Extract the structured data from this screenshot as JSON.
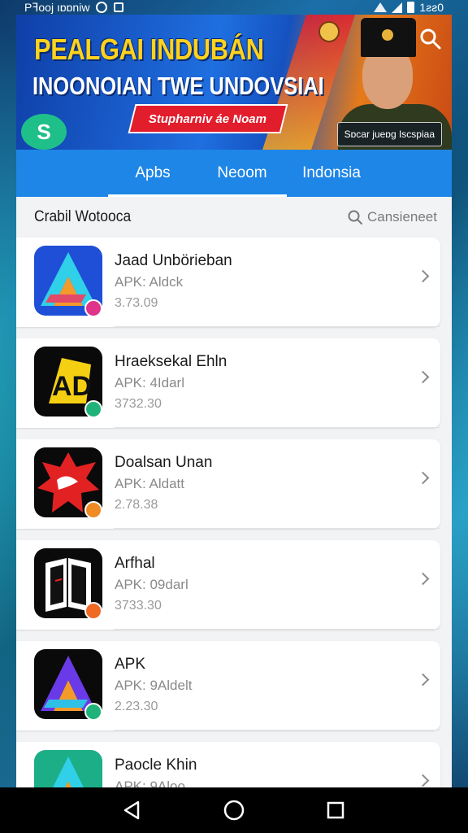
{
  "status_bar": {
    "carrier_text": "Pꟻooj ıɒɒniw",
    "time": "1ƨƨ0"
  },
  "banner": {
    "title_line1": "PEALGAI INDUBÁN",
    "title_line2": "INOONOIAN TWE UNDOVSIAI",
    "ribbon_text": "Stupharniv áe Noam",
    "caption": "Sɒcar jueɒg Iscspiaa",
    "logo_letter": "S"
  },
  "tabs": [
    {
      "label": "Apbs"
    },
    {
      "label": "Neoom"
    },
    {
      "label": "Indonsia"
    }
  ],
  "section": {
    "title": "Crabil Wotooca",
    "search_label": "Cansieneet"
  },
  "apps": [
    {
      "name": "Jaad Unbörieban",
      "type": "APK: Aldck",
      "version": "3.73.09",
      "badge_color": "#e0338a",
      "icon": "a-blue-icon"
    },
    {
      "name": "Hraeksekal Ehln",
      "type": "APK: 4Idarl",
      "version": "3732.30",
      "badge_color": "#1fb37a",
      "icon": "ad-yellow-icon"
    },
    {
      "name": "Doalsan Unan",
      "type": "APK: Aldatt",
      "version": "2.78.38",
      "badge_color": "#f08a24",
      "icon": "red-splash-icon"
    },
    {
      "name": "Arfhal",
      "type": "APK: 09darl",
      "version": "3733.30",
      "badge_color": "#f06a24",
      "icon": "book-icon"
    },
    {
      "name": "APK",
      "type": "APK: 9Aldelt",
      "version": "2.23.30",
      "badge_color": "#1fb37a",
      "icon": "a-purple-icon"
    },
    {
      "name": "Paocle Khin",
      "type": "APK: 9Aloo",
      "version": "",
      "badge_color": "#1fb37a",
      "icon": "a-green-icon"
    }
  ]
}
